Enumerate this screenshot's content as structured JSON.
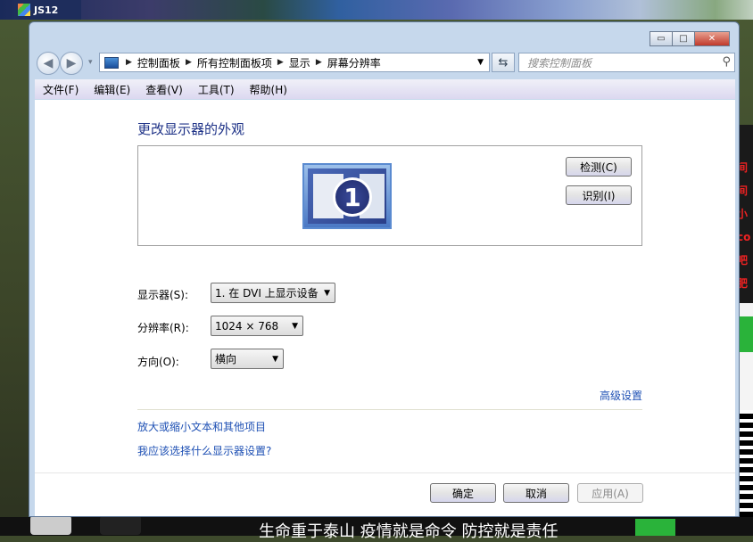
{
  "taskbar": {
    "app_title": "JS12"
  },
  "window": {
    "controls": {
      "minimize": "▭",
      "maximize": "□",
      "close": "✕"
    },
    "nav": {
      "back": "◀",
      "forward": "▶",
      "dropdown": "▾"
    },
    "breadcrumb": [
      "控制面板",
      "所有控制面板项",
      "显示",
      "屏幕分辨率"
    ],
    "breadcrumb_separator": "▶",
    "address_dropdown": "▼",
    "refresh_icon": "⇆",
    "search_placeholder": "搜索控制面板",
    "search_icon": "⚲",
    "menu": [
      "文件(F)",
      "编辑(E)",
      "查看(V)",
      "工具(T)",
      "帮助(H)"
    ]
  },
  "content": {
    "title": "更改显示器的外观",
    "monitor_number": "1",
    "detect_button": "检测(C)",
    "identify_button": "识别(I)",
    "display": {
      "label": "显示器(S):",
      "value": "1. 在 DVI 上显示设备"
    },
    "resolution": {
      "label": "分辨率(R):",
      "value": "1024 × 768"
    },
    "orientation": {
      "label": "方向(O):",
      "value": "横向"
    },
    "dropdown_arrow": "▼",
    "advanced_link": "高级设置",
    "text_size_link": "放大或缩小文本和其他项目",
    "help_link": "我应该选择什么显示器设置?",
    "ok_button": "确定",
    "cancel_button": "取消",
    "apply_button": "应用(A)"
  },
  "background": {
    "right_text": "间\n间\n小\nco\n吧\n肥",
    "bottom_text": "生命重于泰山 疫情就是命令 防控就是责任"
  }
}
